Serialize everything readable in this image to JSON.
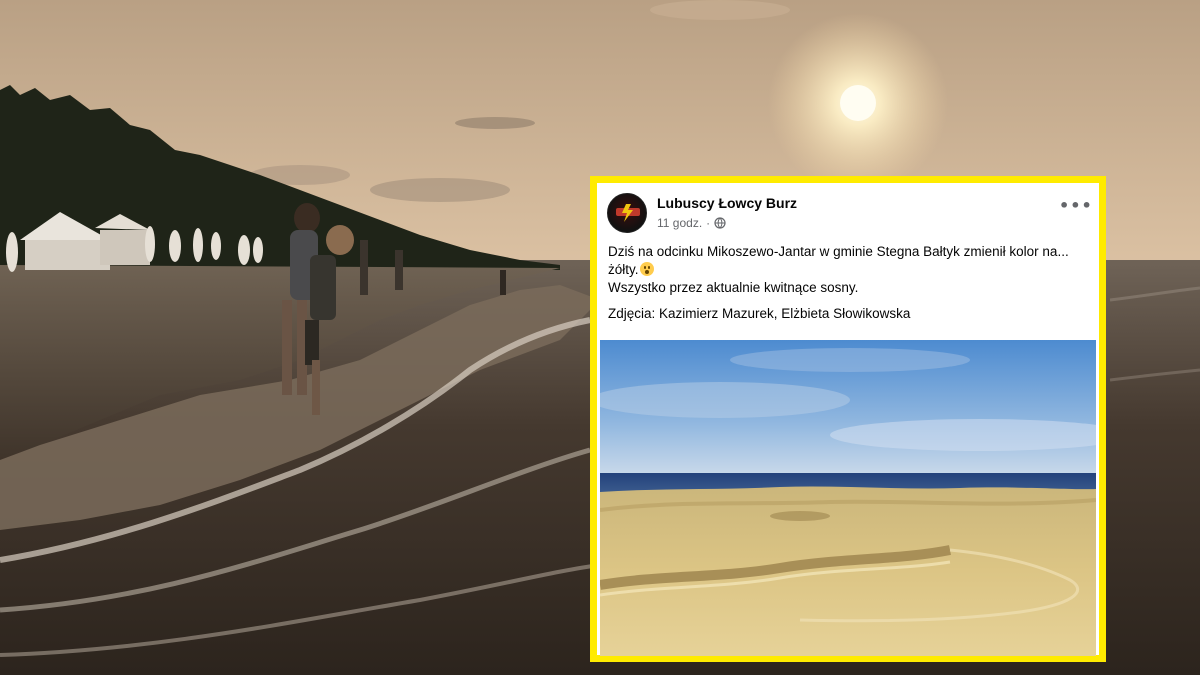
{
  "post": {
    "author": "Lubuscy Łowcy Burz",
    "time": "11 godz.",
    "separator": "·",
    "more_label": "•••",
    "line1": "Dziś na odcinku Mikoszewo-Jantar w gminie Stegna Bałtyk zmienił kolor na... żółty.",
    "line2": "Wszystko przez aktualnie kwitnące sosny.",
    "credits": "Zdjęcia:  Kazimierz Mazurek, Elżbieta Słowikowska",
    "emoji": "astonished-face",
    "privacy_icon": "globe-icon",
    "avatar_logo": "Łowcy Burz lightning logo"
  },
  "colors": {
    "frame": "#ffeb00",
    "sky": "#d8bfa2",
    "sea": "#3c3128",
    "pollen": "#d9c07a"
  }
}
